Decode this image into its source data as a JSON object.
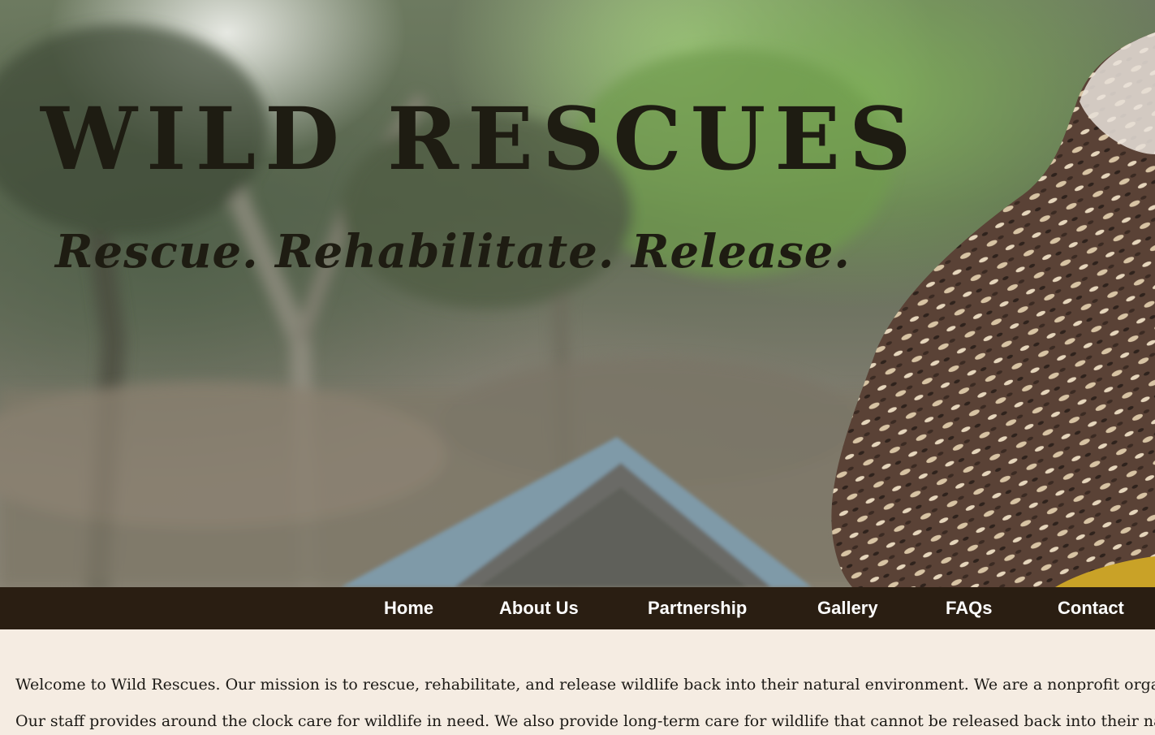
{
  "hero": {
    "title": "WILD RESCUES",
    "tagline": "Rescue. Rehabilitate. Release."
  },
  "nav": {
    "items": [
      {
        "label": "Home"
      },
      {
        "label": "About Us"
      },
      {
        "label": "Partnership"
      },
      {
        "label": "Gallery"
      },
      {
        "label": "FAQs"
      },
      {
        "label": "Contact"
      }
    ]
  },
  "content": {
    "paragraph_1": "Welcome to Wild Rescues. Our mission is to rescue, rehabilitate, and release wildlife back into their natural environment. We are a nonprofit organization",
    "paragraph_2": "Our staff provides around the clock care for wildlife in need. We also provide long-term care for wildlife that cannot be released back into their natural environment."
  },
  "colors": {
    "nav_background": "#2a1e12",
    "nav_text": "#ffffff",
    "page_background": "#f5ece2",
    "title_text": "#1e1c12"
  }
}
